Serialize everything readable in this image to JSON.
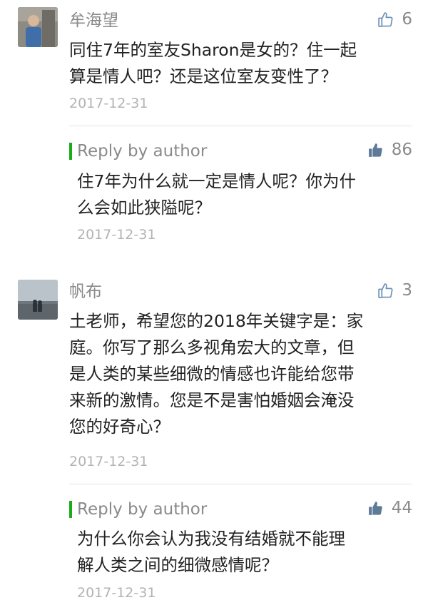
{
  "comments": [
    {
      "author": "牟海望",
      "likes": "6",
      "text_lines": [
        "同住7年的室友Sharon是女的？住一起",
        "算是情人吧？还是这位室友变性了？"
      ],
      "date": "2017-12-31",
      "reply": {
        "label": "Reply by author",
        "likes": "86",
        "text_lines": [
          "住7年为什么就一定是情人呢？你为什",
          "么会如此狭隘呢？"
        ],
        "date": "2017-12-31"
      }
    },
    {
      "author": "帆布",
      "likes": "3",
      "text_lines": [
        "土老师，希望您的2018年关键字是：家",
        "庭。你写了那么多视角宏大的文章，但",
        "是人类的某些细微的情感也许能给您带",
        "来新的激情。您是不是害怕婚姻会淹没",
        "您的好奇心？"
      ],
      "date": "2017-12-31",
      "reply": {
        "label": "Reply by author",
        "likes": "44",
        "text_lines": [
          "为什么你会认为我没有结婚就不能理",
          "解人类之间的细微感情呢？"
        ],
        "date": "2017-12-31"
      }
    }
  ],
  "icons": {
    "like_outline": "thumbs-up-outline-icon",
    "like_filled": "thumbs-up-filled-icon"
  },
  "colors": {
    "reply_bar": "#1aad19",
    "like_outline": "#6b8fb5",
    "like_filled": "#5d7a99"
  }
}
